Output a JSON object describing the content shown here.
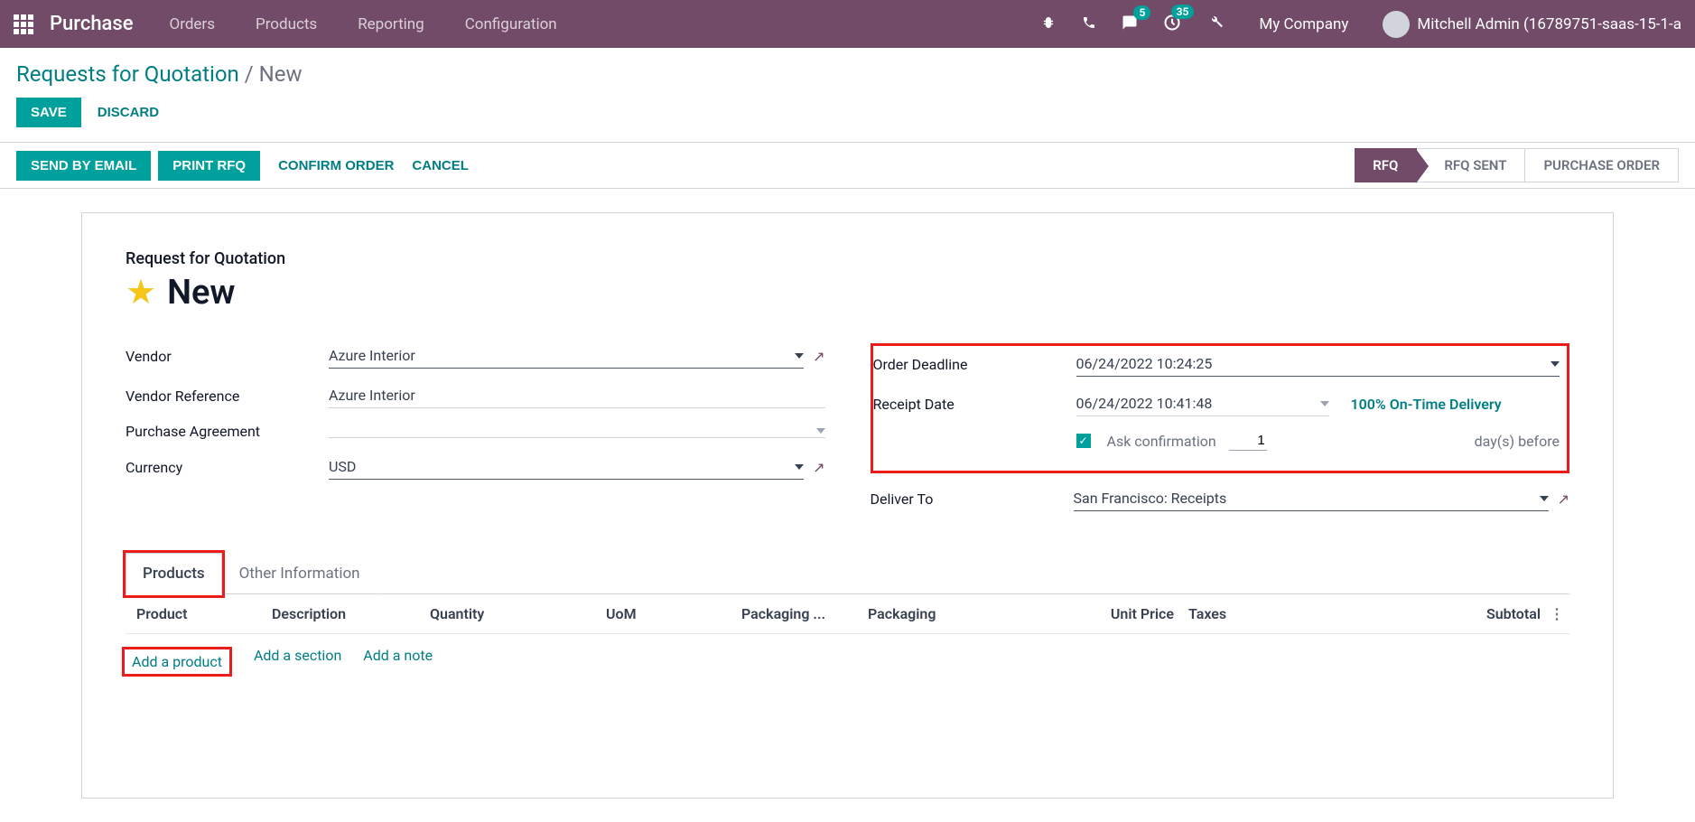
{
  "topbar": {
    "app_title": "Purchase",
    "menus": [
      "Orders",
      "Products",
      "Reporting",
      "Configuration"
    ],
    "chat_badge": "5",
    "activity_badge": "35",
    "company": "My Company",
    "user": "Mitchell Admin (16789751-saas-15-1-a"
  },
  "breadcrumb": {
    "root": "Requests for Quotation",
    "sep": "/",
    "current": "New"
  },
  "buttons": {
    "save": "SAVE",
    "discard": "DISCARD",
    "send_email": "SEND BY EMAIL",
    "print_rfq": "PRINT RFQ",
    "confirm": "CONFIRM ORDER",
    "cancel": "CANCEL"
  },
  "status_steps": {
    "rfq": "RFQ",
    "rfq_sent": "RFQ SENT",
    "po": "PURCHASE ORDER"
  },
  "form": {
    "type_label": "Request for Quotation",
    "title": "New",
    "left": {
      "vendor_label": "Vendor",
      "vendor_value": "Azure Interior",
      "vendor_ref_label": "Vendor Reference",
      "vendor_ref_value": "Azure Interior",
      "agreement_label": "Purchase Agreement",
      "agreement_value": "",
      "currency_label": "Currency",
      "currency_value": "USD"
    },
    "right": {
      "order_deadline_label": "Order Deadline",
      "order_deadline_value": "06/24/2022 10:24:25",
      "receipt_date_label": "Receipt Date",
      "receipt_date_value": "06/24/2022 10:41:48",
      "on_time_link": "100% On-Time Delivery",
      "ask_confirm_label": "Ask confirmation",
      "ask_days_value": "1",
      "days_before": "day(s) before",
      "deliver_to_label": "Deliver To",
      "deliver_to_value": "San Francisco: Receipts"
    }
  },
  "tabs": {
    "products": "Products",
    "other": "Other Information"
  },
  "columns": {
    "product": "Product",
    "description": "Description",
    "quantity": "Quantity",
    "uom": "UoM",
    "packaging_qty": "Packaging ...",
    "packaging": "Packaging",
    "unit_price": "Unit Price",
    "taxes": "Taxes",
    "subtotal": "Subtotal"
  },
  "add_row": {
    "add_product": "Add a product",
    "add_section": "Add a section",
    "add_note": "Add a note"
  }
}
